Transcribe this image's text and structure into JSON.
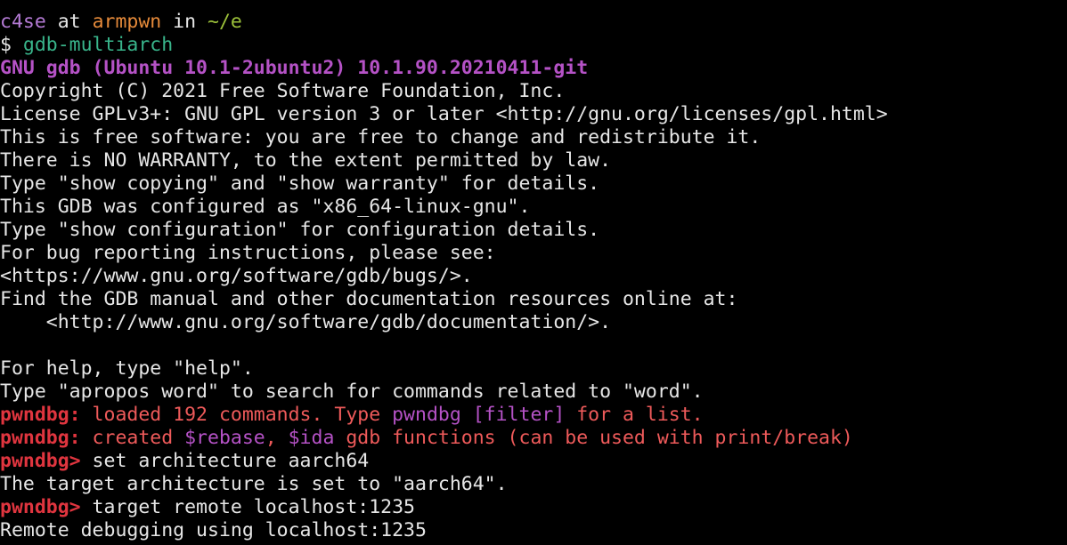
{
  "prompt": {
    "user": "c4se",
    "at": " at ",
    "host": "armpwn",
    "in": " in ",
    "path": "~/e"
  },
  "command_line": {
    "symbol": "$ ",
    "command": "gdb-multiarch"
  },
  "banner": {
    "version": "GNU gdb (Ubuntu 10.1-2ubuntu2) 10.1.90.20210411-git",
    "lines": [
      "Copyright (C) 2021 Free Software Foundation, Inc.",
      "License GPLv3+: GNU GPL version 3 or later <http://gnu.org/licenses/gpl.html>",
      "This is free software: you are free to change and redistribute it.",
      "There is NO WARRANTY, to the extent permitted by law.",
      "Type \"show copying\" and \"show warranty\" for details.",
      "This GDB was configured as \"x86_64-linux-gnu\".",
      "Type \"show configuration\" for configuration details.",
      "For bug reporting instructions, please see:",
      "<https://www.gnu.org/software/gdb/bugs/>.",
      "Find the GDB manual and other documentation resources online at:",
      "    <http://www.gnu.org/software/gdb/documentation/>.",
      "",
      "For help, type \"help\".",
      "Type \"apropos word\" to search for commands related to \"word\"."
    ]
  },
  "pwndbg_loaded": {
    "label": "pwndbg:",
    "text_before": " loaded 192 commands. Type ",
    "highlight": "pwndbg [filter]",
    "text_after": " for a list."
  },
  "pwndbg_created": {
    "label": "pwndbg:",
    "text_before": " created ",
    "rebase": "$rebase",
    "comma": ", ",
    "ida": "$ida",
    "text_after": " gdb functions (can be used with print/break)"
  },
  "session": [
    {
      "prompt": "pwndbg>",
      "input": " set architecture aarch64"
    },
    {
      "output": "The target architecture is set to \"aarch64\"."
    },
    {
      "prompt": "pwndbg>",
      "input": " target remote localhost:1235"
    },
    {
      "output": "Remote debugging using localhost:1235"
    }
  ]
}
